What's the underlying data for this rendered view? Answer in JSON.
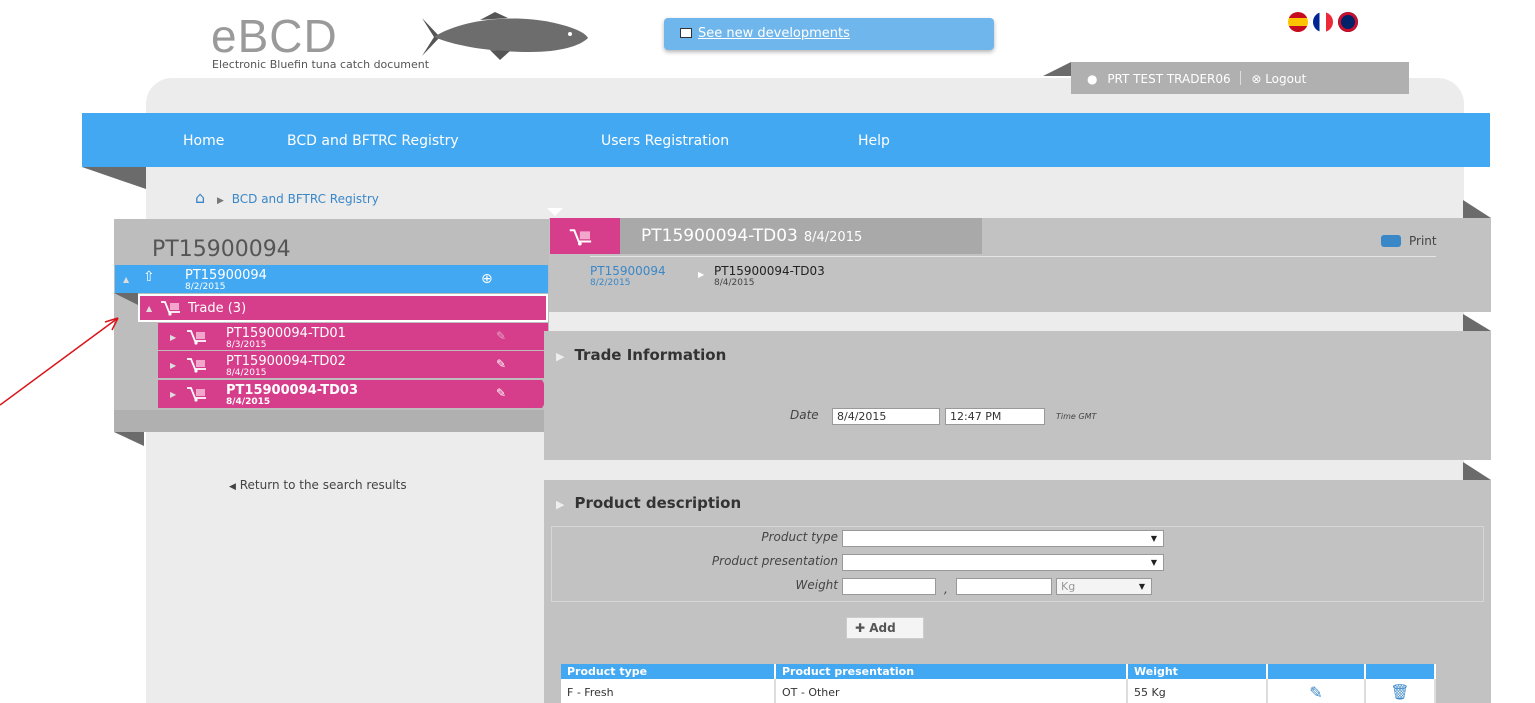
{
  "header": {
    "logo": "eBCD",
    "subtitle": "Electronic Bluefin tuna catch document",
    "news_link": "See new developments",
    "user": "PRT TEST TRADER06",
    "logout": "Logout"
  },
  "nav": {
    "items": [
      "Home",
      "BCD and BFTRC Registry",
      "Users Registration",
      "Help"
    ]
  },
  "breadcrumb": {
    "label": "BCD and BFTRC Registry"
  },
  "left_panel": {
    "title": "PT15900094",
    "root": {
      "id": "PT15900094",
      "date": "8/2/2015"
    },
    "group": "Trade (3)",
    "trades": [
      {
        "id": "PT15900094-TD01",
        "date": "8/3/2015"
      },
      {
        "id": "PT15900094-TD02",
        "date": "8/4/2015"
      },
      {
        "id": "PT15900094-TD03",
        "date": "8/4/2015"
      }
    ],
    "return_link": "Return to the search results"
  },
  "document": {
    "title": "PT15900094-TD03",
    "title_date": "8/4/2015",
    "print": "Print",
    "path_parent": "PT15900094",
    "path_parent_date": "8/2/2015",
    "path_current": "PT15900094-TD03",
    "path_current_date": "8/4/2015"
  },
  "trade_info": {
    "title": "Trade Information",
    "date_label": "Date",
    "date_value": "8/4/2015",
    "time_value": "12:47 PM",
    "time_suffix": "Time GMT"
  },
  "product": {
    "title": "Product description",
    "type_label": "Product type",
    "presentation_label": "Product presentation",
    "weight_label": "Weight",
    "weight_sep": ",",
    "unit": "Kg",
    "add_button": "Add",
    "columns": [
      "Product type",
      "Product presentation",
      "Weight"
    ],
    "rows": [
      {
        "type": "F - Fresh",
        "presentation": "OT - Other",
        "weight": "55 Kg"
      }
    ]
  },
  "colors": {
    "nav_blue": "#42a8f2",
    "magenta": "#d63d8a",
    "panel_gray": "#c2c2c2"
  }
}
